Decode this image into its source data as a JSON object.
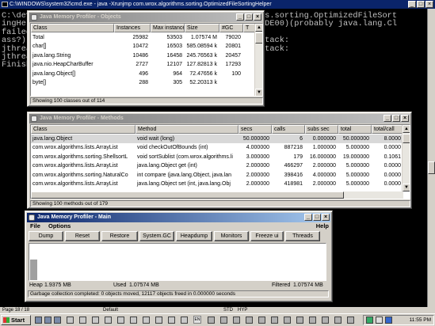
{
  "console": {
    "title": "C:\\WINDOWS\\system32\\cmd.exe - java -Xrunjmp com.wrox.algorithms.sorting.OptimizedFileSortingHelper",
    "lines": [
      "C:\\dev",
      "ingHel",
      "failed",
      "ass?)",
      "jthrea",
      "jthrea",
      "Finish"
    ],
    "right_lines": [
      "",
      "ms.sorting.OptimizedFileSort",
      "IDE00)(probably java.lang.Cl",
      "",
      "stack:",
      "stack:",
      ""
    ],
    "min_btn": "_",
    "max_btn": "□",
    "close_btn": "×"
  },
  "objects_window": {
    "title": "Java Memory Profiler - Objects",
    "columns": [
      "Class",
      "Instances",
      "Max instances",
      "Size",
      "#GC",
      "T"
    ],
    "rows": [
      [
        "Total",
        "25982",
        "53503",
        "1.07574 M",
        "79020",
        ""
      ],
      [
        "char[]",
        "10472",
        "16503",
        "585.08594 k",
        "20801",
        ""
      ],
      [
        "java.lang.String",
        "10486",
        "16458",
        "245.76563 k",
        "20457",
        ""
      ],
      [
        "java.nio.HeapCharBuffer",
        "2727",
        "12107",
        "127.82813 k",
        "17293",
        ""
      ],
      [
        "java.lang.Object[]",
        "496",
        "964",
        "72.47656 k",
        "100",
        ""
      ],
      [
        "byte[]",
        "288",
        "305",
        "52.20313 k",
        "",
        ""
      ]
    ],
    "status": "Showing 100 classes out of 114"
  },
  "methods_window": {
    "title": "Java Memory Profiler - Methods",
    "columns": [
      "Class",
      "Method",
      "secs",
      "calls",
      "subs sec",
      "total",
      "total/call"
    ],
    "rows": [
      [
        "java.lang.Object",
        "void wait (long)",
        "50.000000",
        "6",
        "0.000000",
        "50.000000",
        "8.0000"
      ],
      [
        "com.wrox.algorithms.lists.ArrayList",
        "void checkOutOfBounds (int)",
        "4.000000",
        "887218",
        "1.000000",
        "5.000000",
        "0.0000"
      ],
      [
        "com.wrox.algorithms.sorting.ShellsortL",
        "void sortSublist (com.wrox.algorithms.li",
        "3.000000",
        "179",
        "16.000000",
        "19.000000",
        "0.1061"
      ],
      [
        "com.wrox.algorithms.lists.ArrayList",
        "java.lang.Object get (int)",
        "2.000000",
        "466297",
        "2.000000",
        "5.000000",
        "0.0000"
      ],
      [
        "com.wrox.algorithms.sorting.NaturalCo",
        "int compare (java.lang.Object, java.lan",
        "2.000000",
        "398416",
        "4.000000",
        "5.000000",
        "0.0000"
      ],
      [
        "com.wrox.algorithms.lists.ArrayList",
        "java.lang.Object set (int, java.lang.Obj",
        "2.000000",
        "418981",
        "2.000000",
        "5.000000",
        "0.0000"
      ]
    ],
    "status": "Showing 100 methods out of 179"
  },
  "main_window": {
    "title": "Java Memory Profiler - Main",
    "menu": {
      "file": "File",
      "options": "Options",
      "help": "Help"
    },
    "buttons": [
      "Dump",
      "Reset",
      "Restore",
      "System.GC",
      "Heapdump",
      "Monitors",
      "Freeze ui",
      "Threads"
    ],
    "heap_label": "Heap",
    "heap_value": "1.9375 MB",
    "used_label": "Used",
    "used_value": "1.07574 MB",
    "filtered_label": "Filtered",
    "filtered_value": "1.07574 MB",
    "heap_used_fraction": 0.555,
    "status": "Garbage collection completed: 0 objects moved, 12117 objects freed in 0.000000 seconds"
  },
  "status_strip": {
    "page": "Page 18 / 18",
    "style": "Default",
    "mode_std": "STD",
    "mode_hyp": "HYP"
  },
  "taskbar": {
    "start": "Start",
    "lang": "EN",
    "clock": "11:55 PM"
  }
}
